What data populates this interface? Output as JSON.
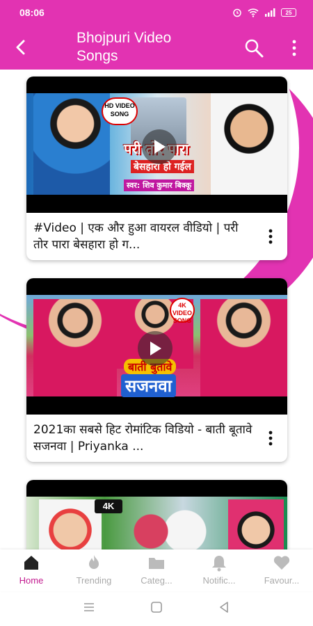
{
  "status_bar": {
    "time": "08:06",
    "battery": "25"
  },
  "app_bar": {
    "title": "Bhojpuri Video Songs"
  },
  "colors": {
    "primary": "#e233b2",
    "active_nav": "#c21a8f",
    "inactive_nav": "#aaaaaa"
  },
  "videos": [
    {
      "title": "#Video | एक और हुआ वायरल वीडियो | परी तोर पारा बेसहारा हो ग...",
      "badge": "HD VIDEO SONG",
      "thumb_title_1": "परी तोर पारा",
      "thumb_title_2": "बेसहारा हो गईल",
      "thumb_credit": "स्वर: शिव कुमार बिक्कू"
    },
    {
      "title": "2021का सबसे हिट रोमांटिक विडियो - बाती  बूतावे सजनवा | Priyanka ...",
      "badge": "4K VIDEO SONG",
      "thumb_title_1": "बाती बुतावे",
      "thumb_title_2": "सजनवा"
    },
    {
      "title": "",
      "badge": "4K"
    }
  ],
  "bottom_nav": {
    "items": [
      {
        "label": "Home",
        "icon": "home-icon",
        "active": true
      },
      {
        "label": "Trending",
        "icon": "flame-icon",
        "active": false
      },
      {
        "label": "Categ...",
        "icon": "folder-icon",
        "active": false
      },
      {
        "label": "Notific...",
        "icon": "bell-icon",
        "active": false
      },
      {
        "label": "Favour...",
        "icon": "heart-icon",
        "active": false
      }
    ]
  }
}
